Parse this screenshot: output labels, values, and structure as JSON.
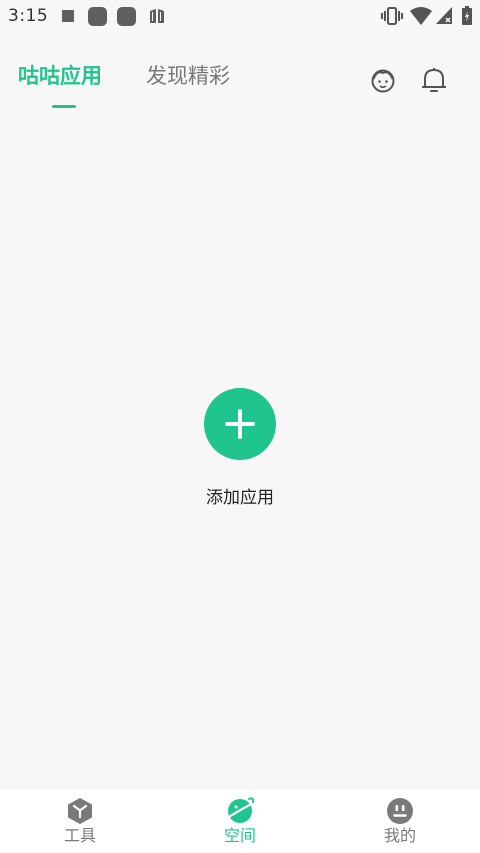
{
  "status_bar": {
    "time": "3:15"
  },
  "header": {
    "tabs": [
      {
        "label": "咕咕应用",
        "active": true
      },
      {
        "label": "发现精彩",
        "active": false
      }
    ],
    "icons": [
      "face-icon",
      "bell-icon"
    ]
  },
  "main": {
    "add_label": "添加应用"
  },
  "bottom_nav": {
    "items": [
      {
        "label": "工具",
        "icon": "cube-icon",
        "active": false
      },
      {
        "label": "空间",
        "icon": "planet-icon",
        "active": true
      },
      {
        "label": "我的",
        "icon": "smiley-icon",
        "active": false
      }
    ]
  },
  "colors": {
    "accent": "#20c48e",
    "inactive": "#7a7a7a",
    "background": "#f7f7f7"
  }
}
